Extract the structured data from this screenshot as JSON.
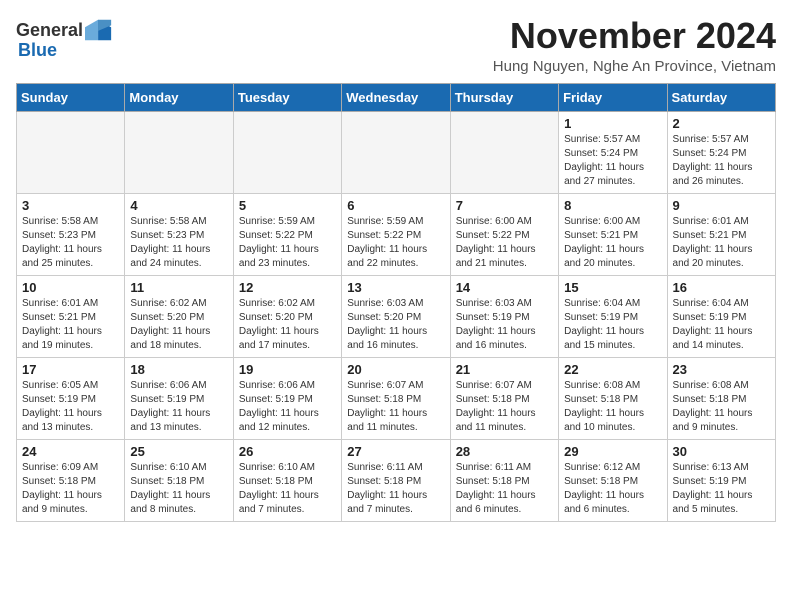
{
  "header": {
    "logo": {
      "general": "General",
      "blue": "Blue"
    },
    "title": "November 2024",
    "location": "Hung Nguyen, Nghe An Province, Vietnam"
  },
  "weekdays": [
    "Sunday",
    "Monday",
    "Tuesday",
    "Wednesday",
    "Thursday",
    "Friday",
    "Saturday"
  ],
  "weeks": [
    [
      {
        "day": "",
        "info": ""
      },
      {
        "day": "",
        "info": ""
      },
      {
        "day": "",
        "info": ""
      },
      {
        "day": "",
        "info": ""
      },
      {
        "day": "",
        "info": ""
      },
      {
        "day": "1",
        "info": "Sunrise: 5:57 AM\nSunset: 5:24 PM\nDaylight: 11 hours\nand 27 minutes."
      },
      {
        "day": "2",
        "info": "Sunrise: 5:57 AM\nSunset: 5:24 PM\nDaylight: 11 hours\nand 26 minutes."
      }
    ],
    [
      {
        "day": "3",
        "info": "Sunrise: 5:58 AM\nSunset: 5:23 PM\nDaylight: 11 hours\nand 25 minutes."
      },
      {
        "day": "4",
        "info": "Sunrise: 5:58 AM\nSunset: 5:23 PM\nDaylight: 11 hours\nand 24 minutes."
      },
      {
        "day": "5",
        "info": "Sunrise: 5:59 AM\nSunset: 5:22 PM\nDaylight: 11 hours\nand 23 minutes."
      },
      {
        "day": "6",
        "info": "Sunrise: 5:59 AM\nSunset: 5:22 PM\nDaylight: 11 hours\nand 22 minutes."
      },
      {
        "day": "7",
        "info": "Sunrise: 6:00 AM\nSunset: 5:22 PM\nDaylight: 11 hours\nand 21 minutes."
      },
      {
        "day": "8",
        "info": "Sunrise: 6:00 AM\nSunset: 5:21 PM\nDaylight: 11 hours\nand 20 minutes."
      },
      {
        "day": "9",
        "info": "Sunrise: 6:01 AM\nSunset: 5:21 PM\nDaylight: 11 hours\nand 20 minutes."
      }
    ],
    [
      {
        "day": "10",
        "info": "Sunrise: 6:01 AM\nSunset: 5:21 PM\nDaylight: 11 hours\nand 19 minutes."
      },
      {
        "day": "11",
        "info": "Sunrise: 6:02 AM\nSunset: 5:20 PM\nDaylight: 11 hours\nand 18 minutes."
      },
      {
        "day": "12",
        "info": "Sunrise: 6:02 AM\nSunset: 5:20 PM\nDaylight: 11 hours\nand 17 minutes."
      },
      {
        "day": "13",
        "info": "Sunrise: 6:03 AM\nSunset: 5:20 PM\nDaylight: 11 hours\nand 16 minutes."
      },
      {
        "day": "14",
        "info": "Sunrise: 6:03 AM\nSunset: 5:19 PM\nDaylight: 11 hours\nand 16 minutes."
      },
      {
        "day": "15",
        "info": "Sunrise: 6:04 AM\nSunset: 5:19 PM\nDaylight: 11 hours\nand 15 minutes."
      },
      {
        "day": "16",
        "info": "Sunrise: 6:04 AM\nSunset: 5:19 PM\nDaylight: 11 hours\nand 14 minutes."
      }
    ],
    [
      {
        "day": "17",
        "info": "Sunrise: 6:05 AM\nSunset: 5:19 PM\nDaylight: 11 hours\nand 13 minutes."
      },
      {
        "day": "18",
        "info": "Sunrise: 6:06 AM\nSunset: 5:19 PM\nDaylight: 11 hours\nand 13 minutes."
      },
      {
        "day": "19",
        "info": "Sunrise: 6:06 AM\nSunset: 5:19 PM\nDaylight: 11 hours\nand 12 minutes."
      },
      {
        "day": "20",
        "info": "Sunrise: 6:07 AM\nSunset: 5:18 PM\nDaylight: 11 hours\nand 11 minutes."
      },
      {
        "day": "21",
        "info": "Sunrise: 6:07 AM\nSunset: 5:18 PM\nDaylight: 11 hours\nand 11 minutes."
      },
      {
        "day": "22",
        "info": "Sunrise: 6:08 AM\nSunset: 5:18 PM\nDaylight: 11 hours\nand 10 minutes."
      },
      {
        "day": "23",
        "info": "Sunrise: 6:08 AM\nSunset: 5:18 PM\nDaylight: 11 hours\nand 9 minutes."
      }
    ],
    [
      {
        "day": "24",
        "info": "Sunrise: 6:09 AM\nSunset: 5:18 PM\nDaylight: 11 hours\nand 9 minutes."
      },
      {
        "day": "25",
        "info": "Sunrise: 6:10 AM\nSunset: 5:18 PM\nDaylight: 11 hours\nand 8 minutes."
      },
      {
        "day": "26",
        "info": "Sunrise: 6:10 AM\nSunset: 5:18 PM\nDaylight: 11 hours\nand 7 minutes."
      },
      {
        "day": "27",
        "info": "Sunrise: 6:11 AM\nSunset: 5:18 PM\nDaylight: 11 hours\nand 7 minutes."
      },
      {
        "day": "28",
        "info": "Sunrise: 6:11 AM\nSunset: 5:18 PM\nDaylight: 11 hours\nand 6 minutes."
      },
      {
        "day": "29",
        "info": "Sunrise: 6:12 AM\nSunset: 5:18 PM\nDaylight: 11 hours\nand 6 minutes."
      },
      {
        "day": "30",
        "info": "Sunrise: 6:13 AM\nSunset: 5:19 PM\nDaylight: 11 hours\nand 5 minutes."
      }
    ]
  ]
}
